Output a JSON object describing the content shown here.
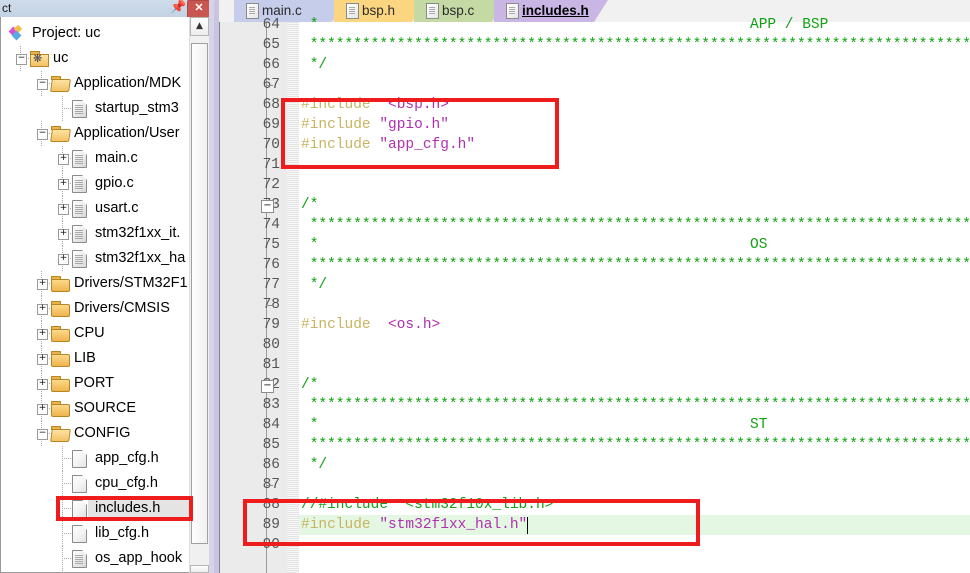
{
  "panel": {
    "title": "ct",
    "pin_icon": "pin-icon",
    "close_label": "✕"
  },
  "tree": {
    "items": [
      {
        "indent": 0,
        "icon": "uvision-project-icon",
        "label": "Project: uc",
        "expander": "",
        "kind": "project"
      },
      {
        "indent": 1,
        "icon": "target-icon",
        "label": "uc",
        "expander": "−",
        "kind": "target"
      },
      {
        "indent": 2,
        "icon": "folder-open-icon",
        "label": "Application/MDK",
        "expander": "−",
        "kind": "group"
      },
      {
        "indent": 3,
        "icon": "file-source-icon",
        "label": "startup_stm3",
        "expander": "",
        "kind": "file"
      },
      {
        "indent": 2,
        "icon": "folder-open-icon",
        "label": "Application/User",
        "expander": "−",
        "kind": "group"
      },
      {
        "indent": 3,
        "icon": "file-source-icon",
        "label": "main.c",
        "expander": "+",
        "kind": "file"
      },
      {
        "indent": 3,
        "icon": "file-source-icon",
        "label": "gpio.c",
        "expander": "+",
        "kind": "file"
      },
      {
        "indent": 3,
        "icon": "file-source-icon",
        "label": "usart.c",
        "expander": "+",
        "kind": "file"
      },
      {
        "indent": 3,
        "icon": "file-source-icon",
        "label": "stm32f1xx_it.",
        "expander": "+",
        "kind": "file"
      },
      {
        "indent": 3,
        "icon": "file-source-icon",
        "label": "stm32f1xx_ha",
        "expander": "+",
        "kind": "file"
      },
      {
        "indent": 2,
        "icon": "folder-icon",
        "label": "Drivers/STM32F1",
        "expander": "+",
        "kind": "group"
      },
      {
        "indent": 2,
        "icon": "folder-icon",
        "label": "Drivers/CMSIS",
        "expander": "+",
        "kind": "group"
      },
      {
        "indent": 2,
        "icon": "folder-icon",
        "label": "CPU",
        "expander": "+",
        "kind": "group"
      },
      {
        "indent": 2,
        "icon": "folder-icon",
        "label": "LIB",
        "expander": "+",
        "kind": "group"
      },
      {
        "indent": 2,
        "icon": "folder-icon",
        "label": "PORT",
        "expander": "+",
        "kind": "group"
      },
      {
        "indent": 2,
        "icon": "folder-icon",
        "label": "SOURCE",
        "expander": "+",
        "kind": "group"
      },
      {
        "indent": 2,
        "icon": "folder-open-icon",
        "label": "CONFIG",
        "expander": "−",
        "kind": "group"
      },
      {
        "indent": 3,
        "icon": "file-header-icon",
        "label": "app_cfg.h",
        "expander": "",
        "kind": "file"
      },
      {
        "indent": 3,
        "icon": "file-header-icon",
        "label": "cpu_cfg.h",
        "expander": "",
        "kind": "file"
      },
      {
        "indent": 3,
        "icon": "file-header-icon",
        "label": "includes.h",
        "expander": "",
        "kind": "file",
        "selected": true
      },
      {
        "indent": 3,
        "icon": "file-header-icon",
        "label": "lib_cfg.h",
        "expander": "",
        "kind": "file"
      },
      {
        "indent": 3,
        "icon": "file-source-icon",
        "label": "os_app_hook",
        "expander": "",
        "kind": "file"
      }
    ],
    "scrollbar": {
      "up_arrow": "▲"
    }
  },
  "tabs": [
    {
      "label": "main.c",
      "color": "#c6cdea",
      "active": false
    },
    {
      "label": "bsp.h",
      "color": "#fcd581",
      "active": false
    },
    {
      "label": "bsp.c",
      "color": "#c5d9a5",
      "active": false
    },
    {
      "label": "includes.h",
      "color": "#c9b6e4",
      "active": true
    }
  ],
  "editor": {
    "lines": [
      {
        "n": "64",
        "text": " *",
        "type": "comment",
        "fold": "",
        "indent_right": ""
      },
      {
        "n": "65",
        "text": " ************************************************************************************",
        "type": "comment"
      },
      {
        "n": "66",
        "text": " */",
        "type": "comment"
      },
      {
        "n": "67",
        "text": "",
        "type": "blank",
        "fold": "end"
      },
      {
        "n": "68",
        "text": "#include  <bsp.h>",
        "type": "include",
        "pp": "#include",
        "arg": "<bsp.h>"
      },
      {
        "n": "69",
        "text": "#include \"gpio.h\"",
        "type": "include",
        "pp": "#include",
        "arg": "\"gpio.h\""
      },
      {
        "n": "70",
        "text": "#include \"app_cfg.h\"",
        "type": "include",
        "pp": "#include",
        "arg": "\"app_cfg.h\""
      },
      {
        "n": "71",
        "text": "",
        "type": "blank"
      },
      {
        "n": "72",
        "text": "",
        "type": "blank"
      },
      {
        "n": "73",
        "text": "/*",
        "type": "comment",
        "fold": "box"
      },
      {
        "n": "74",
        "text": " ************************************************************************************",
        "type": "comment"
      },
      {
        "n": "75",
        "text": " *",
        "type": "comment"
      },
      {
        "n": "76",
        "text": " ************************************************************************************",
        "type": "comment"
      },
      {
        "n": "77",
        "text": " */",
        "type": "comment"
      },
      {
        "n": "78",
        "text": "",
        "type": "blank",
        "fold": "end"
      },
      {
        "n": "79",
        "text": "#include  <os.h>",
        "type": "include",
        "pp": "#include",
        "arg": "<os.h>"
      },
      {
        "n": "80",
        "text": "",
        "type": "blank"
      },
      {
        "n": "81",
        "text": "",
        "type": "blank"
      },
      {
        "n": "82",
        "text": "/*",
        "type": "comment",
        "fold": "box"
      },
      {
        "n": "83",
        "text": " ************************************************************************************",
        "type": "comment"
      },
      {
        "n": "84",
        "text": " *",
        "type": "comment"
      },
      {
        "n": "85",
        "text": " ************************************************************************************",
        "type": "comment"
      },
      {
        "n": "86",
        "text": " */",
        "type": "comment"
      },
      {
        "n": "87",
        "text": "",
        "type": "blank",
        "fold": "end"
      },
      {
        "n": "88",
        "text": "//#include  <stm32f10x_lib.h>",
        "type": "comment"
      },
      {
        "n": "89",
        "text": "#include \"stm32f1xx_hal.h\"",
        "type": "include",
        "pp": "#include",
        "arg": "\"stm32f1xx_hal.h\"",
        "highlight": true,
        "caret": true
      },
      {
        "n": "90",
        "text": "",
        "type": "blank"
      }
    ],
    "banner_labels": [
      {
        "text": "APP / BSP",
        "line": "64"
      },
      {
        "text": "OS",
        "line": "75"
      },
      {
        "text": "ST",
        "line": "84"
      }
    ],
    "colors": {
      "comment": "#14a014",
      "preprocessor": "#c8b560",
      "string": "#b02fb0",
      "current_line": "#e3f7e3",
      "gutter": "#ebebeb",
      "annotation_red": "#ee1c1c"
    }
  }
}
